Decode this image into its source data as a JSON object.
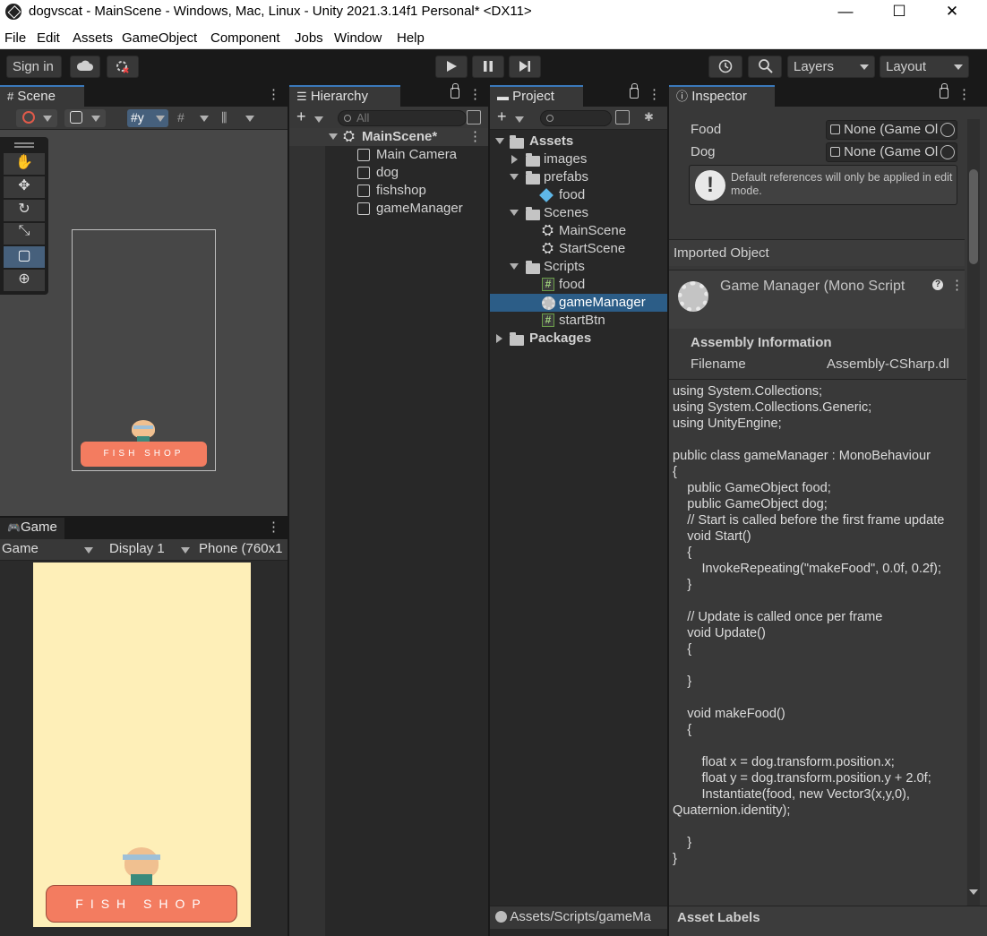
{
  "window": {
    "title": "dogvscat - MainScene - Windows, Mac, Linux - Unity 2021.3.14f1 Personal* <DX11>",
    "minimize": "—",
    "maximize": "☐",
    "close": "✕"
  },
  "menu": [
    "File",
    "Edit",
    "Assets",
    "GameObject",
    "Component",
    "Jobs",
    "Window",
    "Help"
  ],
  "toolbar": {
    "signin": "Sign in",
    "layers": "Layers",
    "layout": "Layout"
  },
  "scene": {
    "tab": "Scene"
  },
  "game": {
    "tab": "Game",
    "mode": "Game",
    "display": "Display 1",
    "resolution": "Phone (760x1"
  },
  "hierarchy": {
    "tab": "Hierarchy",
    "search_placeholder": "All",
    "scene": "MainScene*",
    "items": [
      "Main Camera",
      "dog",
      "fishshop",
      "gameManager"
    ]
  },
  "project": {
    "tab": "Project",
    "assets": "Assets",
    "images": "images",
    "prefabs": "prefabs",
    "prefab_food": "food",
    "scenes": "Scenes",
    "scene1": "MainScene",
    "scene2": "StartScene",
    "scripts": "Scripts",
    "script1": "food",
    "script2": "gameManager",
    "script3": "startBtn",
    "packages": "Packages",
    "path": "Assets/Scripts/gameMa"
  },
  "inspector": {
    "tab": "Inspector",
    "field1_label": "Food",
    "field1_value": "None (Game Ol",
    "field2_label": "Dog",
    "field2_value": "None (Game Ol",
    "help": "Default references will only be applied in edit mode.",
    "imported": "Imported Object",
    "script_title": "Game Manager (Mono Script",
    "assembly_heading": "Assembly Information",
    "filename_label": "Filename",
    "filename_value": "Assembly-CSharp.dl",
    "asset_labels": "Asset Labels",
    "code": "using System.Collections;\nusing System.Collections.Generic;\nusing UnityEngine;\n\npublic class gameManager : MonoBehaviour\n{\n    public GameObject food;\n    public GameObject dog;\n    // Start is called before the first frame update\n    void Start()\n    {\n        InvokeRepeating(\"makeFood\", 0.0f, 0.2f);\n    }\n\n    // Update is called once per frame\n    void Update()\n    {\n\n    }\n\n    void makeFood()\n    {\n\n        float x = dog.transform.position.x;\n        float y = dog.transform.position.y + 2.0f;\n        Instantiate(food, new Vector3(x,y,0), Quaternion.identity);\n\n    }\n}"
  },
  "game_view": {
    "shop_sign": "FISH SHOP"
  },
  "scene_view": {
    "shop_sign": "FISH SHOP"
  }
}
